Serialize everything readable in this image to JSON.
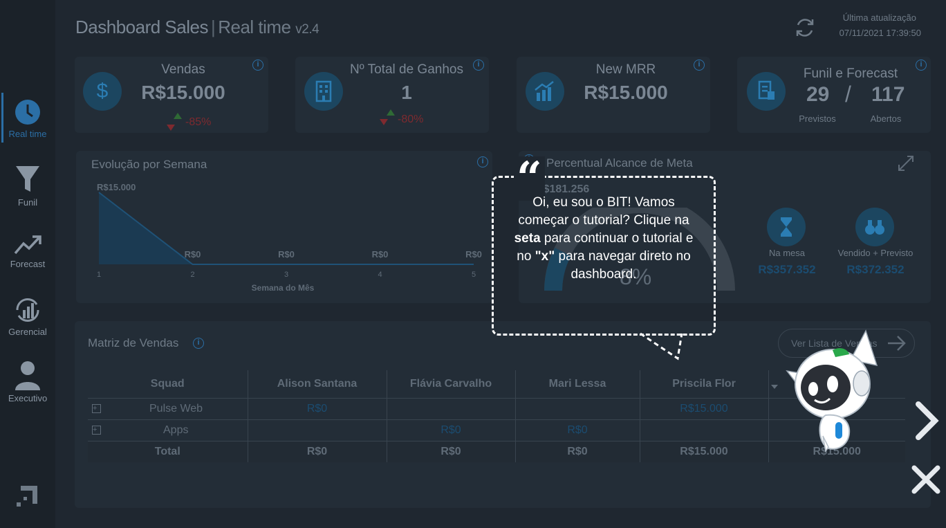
{
  "header": {
    "title": "Dashboard Sales",
    "separator": "|",
    "subtitle": "Real time",
    "version": "v2.4",
    "update_label": "Última atualização",
    "update_date": "07/11/2021 17:39:50"
  },
  "sidebar": {
    "items": [
      {
        "label": "Real time",
        "icon": "clock-icon",
        "active": true
      },
      {
        "label": "Funil",
        "icon": "funnel-icon"
      },
      {
        "label": "Forecast",
        "icon": "trend-icon"
      },
      {
        "label": "Gerencial",
        "icon": "chart-cycle-icon"
      },
      {
        "label": "Executivo",
        "icon": "person-icon"
      }
    ]
  },
  "kpis": {
    "vendas": {
      "title": "Vendas",
      "value": "R$15.000",
      "delta": "-85%"
    },
    "ganhos": {
      "title": "Nº Total de Ganhos",
      "value": "1",
      "delta": "-80%"
    },
    "mrr": {
      "title": "New MRR",
      "value": "R$15.000"
    },
    "funil": {
      "title": "Funil e Forecast",
      "previstos": "29",
      "slash": "/",
      "abertos": "117",
      "previstos_label": "Previstos",
      "abertos_label": "Abertos"
    }
  },
  "evolucao": {
    "title": "Evolução por Semana",
    "xlabel": "Semana do Mês",
    "top_label": "R$15.000"
  },
  "meta": {
    "title": "Percentual Alcance de Meta",
    "value": "R$181.256",
    "percent": "8%",
    "na_mesa_label": "Na mesa",
    "na_mesa_value": "R$357.352",
    "vendido_label": "Vendido + Previsto",
    "vendido_value": "R$372.352"
  },
  "matriz": {
    "title": "Matriz de Vendas",
    "ver_lista": "Ver Lista de Vendas",
    "columns": [
      "Squad",
      "Alison Santana",
      "Flávia Carvalho",
      "Mari Lessa",
      "Priscila Flor",
      ""
    ],
    "rows": [
      {
        "squad": "Pulse Web",
        "cells": [
          "R$0",
          "",
          "",
          "R$15.000",
          ""
        ]
      },
      {
        "squad": "Apps",
        "cells": [
          "",
          "R$0",
          "R$0",
          "",
          ""
        ]
      }
    ],
    "total": {
      "label": "Total",
      "cells": [
        "R$0",
        "R$0",
        "R$0",
        "R$15.000",
        "R$15.000"
      ]
    }
  },
  "tutorial": {
    "line1": "Oi, eu sou o BIT! Vamos",
    "line2": "começar o tutorial? Clique na",
    "bold1": "seta",
    "line3": " para continuar o tutorial e",
    "line4a": "no ",
    "bold2": "\"x\"",
    "line4b": " para navegar direto no",
    "line5": "dashboard."
  },
  "chart_data": {
    "type": "area",
    "title": "Evolução por Semana",
    "xlabel": "Semana do Mês",
    "ylabel": "",
    "categories": [
      "1",
      "2",
      "3",
      "4",
      "5"
    ],
    "values": [
      15000,
      0,
      0,
      0,
      0
    ],
    "value_labels": [
      "R$15.000",
      "R$0",
      "R$0",
      "R$0",
      "R$0"
    ]
  }
}
